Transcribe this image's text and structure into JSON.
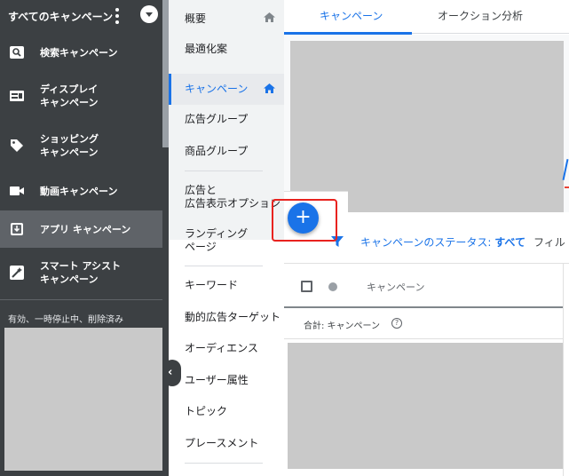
{
  "sidebar": {
    "title": "すべてのキャンペーン",
    "items": [
      {
        "label": "検索キャンペーン",
        "icon": "search-icon"
      },
      {
        "label": "ディスプレイ\nキャンペーン",
        "icon": "display-icon"
      },
      {
        "label": "ショッピング\nキャンペーン",
        "icon": "shopping-tag-icon"
      },
      {
        "label": "動画キャンペーン",
        "icon": "video-camera-icon"
      },
      {
        "label": "アプリ キャンペーン",
        "icon": "app-download-icon"
      },
      {
        "label": "スマート アシスト\nキャンペーン",
        "icon": "magic-wand-icon"
      }
    ],
    "status_filter": "有効、一時停止中、削除済み"
  },
  "page_nav": {
    "items": [
      {
        "label": "概要"
      },
      {
        "label": "最適化案"
      },
      {
        "label": "キャンペーン"
      },
      {
        "label": "広告グループ"
      },
      {
        "label": "商品グループ"
      },
      {
        "label": "広告と\n広告表示オプション"
      },
      {
        "label": "ランディング\nページ"
      },
      {
        "label": "キーワード"
      },
      {
        "label": "動的広告ターゲット"
      },
      {
        "label": "オーディエンス"
      },
      {
        "label": "ユーザー属性"
      },
      {
        "label": "トピック"
      },
      {
        "label": "プレースメント"
      }
    ],
    "collapse_glyph": "‹"
  },
  "tabs": [
    {
      "label": "キャンペーン"
    },
    {
      "label": "オークション分析"
    }
  ],
  "toolbar": {
    "filter_prefix": "キャンペーンのステータス: ",
    "filter_value": "すべて",
    "filter_more": "フィル"
  },
  "table": {
    "column_campaign": "キャンペーン",
    "total_label": "合計: キャンペーン",
    "help_glyph": "?"
  },
  "fab": {
    "glyph": "+"
  },
  "colors": {
    "sidebar_bg": "#3c4043",
    "accent": "#1a73e8",
    "highlight": "#e8231f"
  }
}
